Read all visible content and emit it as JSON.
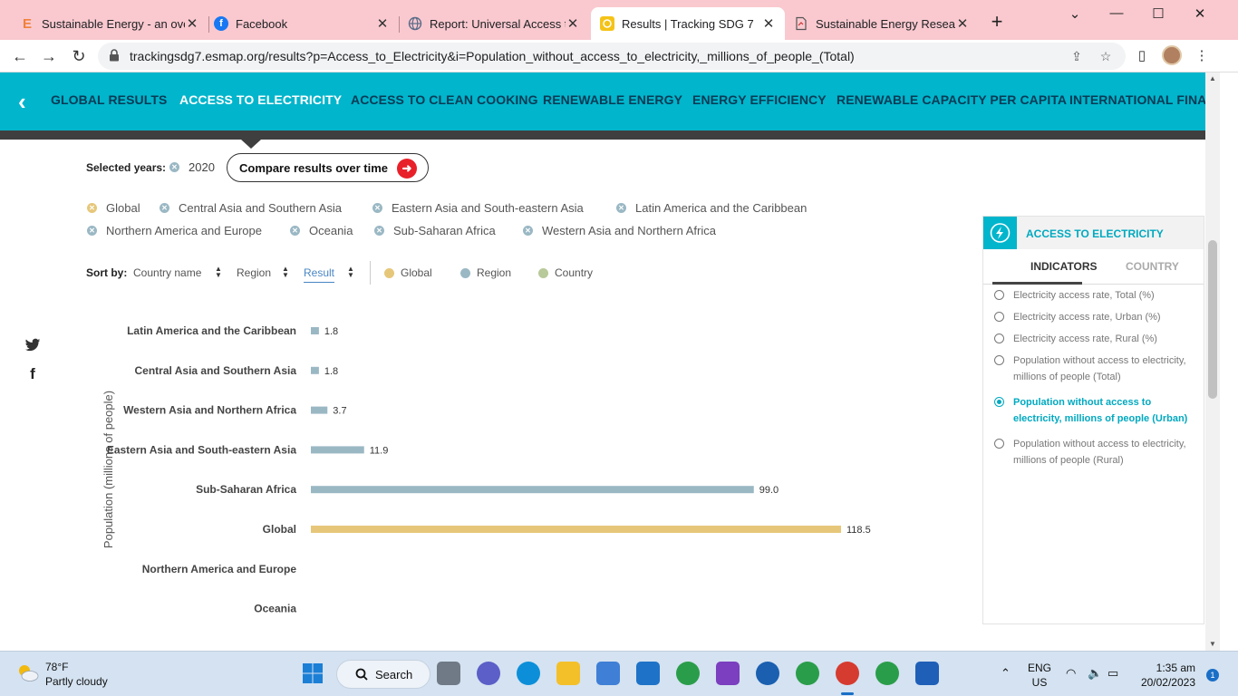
{
  "browser": {
    "tabs": [
      {
        "title": "Sustainable Energy - an over",
        "favicon": "E",
        "icon": "e-icon",
        "color": "#f0813a"
      },
      {
        "title": "Facebook",
        "favicon": "f",
        "icon": "facebook-icon",
        "color": "#1877f2"
      },
      {
        "title": "Report: Universal Access to S",
        "favicon": "",
        "icon": "globe-icon",
        "color": "#6b7ea0"
      },
      {
        "title": "Results | Tracking SDG 7",
        "favicon": "",
        "icon": "sdg-icon",
        "color": "#f5c318",
        "active": true
      },
      {
        "title": "Sustainable Energy Research",
        "favicon": "",
        "icon": "document-icon",
        "color": "#666"
      }
    ],
    "url": "trackingsdg7.esmap.org/results?p=Access_to_Electricity&i=Population_without_access_to_electricity,_millions_of_people_(Total)"
  },
  "nav": {
    "items": [
      "GLOBAL RESULTS",
      "ACCESS TO ELECTRICITY",
      "ACCESS TO CLEAN COOKING",
      "RENEWABLE ENERGY",
      "ENERGY EFFICIENCY",
      "RENEWABLE CAPACITY PER CAPITA",
      "INTERNATIONAL FINANC"
    ],
    "active_index": 1
  },
  "filters": {
    "selected_years_label": "Selected years:",
    "year": "2020",
    "compare_label": "Compare results over time",
    "regions": [
      "Global",
      "Central Asia and Southern Asia",
      "Eastern Asia and South-eastern Asia",
      "Latin America and the Caribbean",
      "Northern America and Europe",
      "Oceania",
      "Sub-Saharan Africa",
      "Western Asia and Northern Africa"
    ]
  },
  "sort": {
    "label": "Sort by:",
    "options": [
      "Country name",
      "Region",
      "Result"
    ],
    "active": "Result",
    "legend": [
      {
        "label": "Global",
        "color": "#e6c77a"
      },
      {
        "label": "Region",
        "color": "#9ab8c4"
      },
      {
        "label": "Country",
        "color": "#b8c99a"
      }
    ]
  },
  "chart_data": {
    "type": "bar",
    "orientation": "horizontal",
    "ylabel": "Population (millions of people)",
    "categories": [
      "Latin America and the Caribbean",
      "Central Asia and Southern Asia",
      "Western Asia and Northern Africa",
      "Eastern Asia and South-eastern Asia",
      "Sub-Saharan Africa",
      "Global",
      "Northern America and Europe",
      "Oceania"
    ],
    "values": [
      1.8,
      1.8,
      3.7,
      11.9,
      99.0,
      118.5,
      null,
      null
    ],
    "value_labels": [
      "1.8",
      "1.8",
      "3.7",
      "11.9",
      "99.0",
      "118.5",
      "",
      ""
    ],
    "kinds": [
      "Region",
      "Region",
      "Region",
      "Region",
      "Region",
      "Global",
      "Region",
      "Region"
    ],
    "colors": {
      "Global": "#e6c77a",
      "Region": "#9ab8c4"
    },
    "xlim": [
      0,
      118.5
    ]
  },
  "panel": {
    "title": "ACCESS TO ELECTRICITY",
    "tabs": [
      "INDICATORS",
      "COUNTRY"
    ],
    "options": [
      "Electricity access rate, Total (%)",
      "Electricity access rate, Urban (%)",
      "Electricity access rate, Rural (%)",
      "Population without access to electricity, millions of people (Total)",
      "Population without access to electricity, millions of people (Urban)",
      "Population without access to electricity, millions of people (Rural)"
    ],
    "selected_index": 4
  },
  "taskbar": {
    "temp": "78°F",
    "weather": "Partly cloudy",
    "search": "Search",
    "lang1": "ENG",
    "lang2": "US",
    "time": "1:35 am",
    "date": "20/02/2023",
    "notifications": "1"
  }
}
